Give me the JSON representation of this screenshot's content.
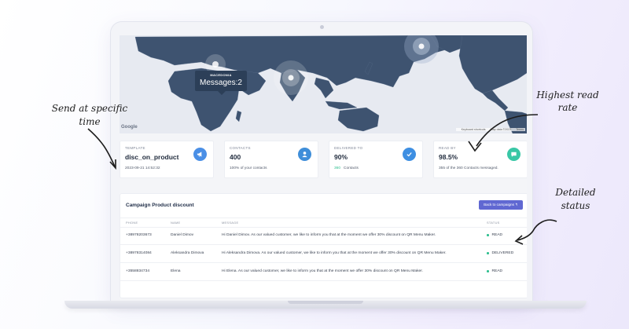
{
  "map": {
    "tooltip_title": "MACEDONIA",
    "tooltip_value": "Messages:2",
    "google_logo": "Google",
    "attribution": [
      "Keyboard shortcuts",
      "Map data ©2023",
      "Terms"
    ]
  },
  "stats": [
    {
      "label": "TEMPLATE",
      "value": "disc_on_product",
      "sub": "2023-09-21 14:52:32",
      "icon": "megaphone-icon",
      "color": "#4a8fe6"
    },
    {
      "label": "CONTACTS",
      "value": "400",
      "sub": "100% of your contacts",
      "icon": "user-icon",
      "color": "#3f8ed9"
    },
    {
      "label": "DELIVERED TO",
      "value": "90%",
      "sub_num": "360",
      "sub": "Contacts",
      "icon": "check-icon",
      "color": "#3e8fe2"
    },
    {
      "label": "READ BY",
      "value": "98.5%",
      "sub": "355 of the 360 Contacts messaged.",
      "icon": "chat-icon",
      "color": "#39c7a6"
    }
  ],
  "campaign": {
    "title": "Campaign Product discount",
    "back_button": "Back to campaigns ↰",
    "columns": [
      "PHONE",
      "NAME",
      "MESSAGE",
      "STATUS"
    ],
    "rows": [
      {
        "phone": "+38978203673",
        "name": "Daniel Dimov",
        "message": "Hi Daniel Dimov. As our valued customer, we like to inform you that at the moment we offer 30% discount on QR Menu Maker.",
        "status": "READ"
      },
      {
        "phone": "+38978314084",
        "name": "Aleksandra Dimova",
        "message": "Hi Aleksandra Dimova. As our valued customer, we like to inform you that at the moment we offer 30% discount on QR Menu Maker.",
        "status": "DELIVERED"
      },
      {
        "phone": "+3558834734",
        "name": "Elena",
        "message": "Hi Elena. As our valued customer, we like to inform you that at the moment we offer 30% discount on QR Menu Maker.",
        "status": "READ"
      }
    ]
  },
  "annotations": {
    "send": "Send at specific time",
    "highest": "Highest read rate",
    "detailed": "Detailed status"
  },
  "colors": {
    "accent": "#6068d2",
    "map_land": "#3e5370",
    "status_dot": "#2fbf8f"
  }
}
